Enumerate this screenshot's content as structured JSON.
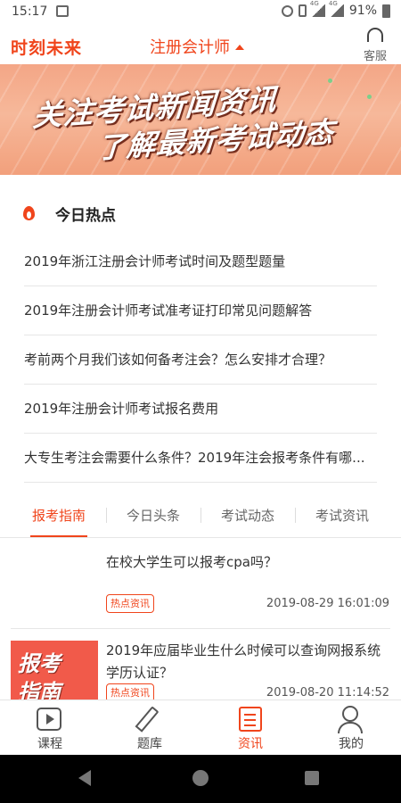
{
  "status_bar": {
    "time": "15:17",
    "signal_label_1": "4G",
    "signal_label_2": "4G",
    "battery": "91%"
  },
  "header": {
    "logo": "时刻未来",
    "title": "注册会计师",
    "service_label": "客服"
  },
  "banner": {
    "line1": "关注考试新闻资讯",
    "line2": "了解最新考试动态"
  },
  "hot": {
    "heading": "今日热点",
    "items": [
      {
        "label": "2019年浙江注册会计师考试时间及题型题量"
      },
      {
        "label": "2019年注册会计师考试准考证打印常见问题解答"
      },
      {
        "label": "考前两个月我们该如何备考注会？怎么安排才合理？"
      },
      {
        "label": "2019年注册会计师考试报名费用"
      },
      {
        "label": "大专生考注会需要什么条件？2019年注会报考条件有哪..."
      }
    ]
  },
  "tabs": [
    {
      "label": "报考指南",
      "active": true
    },
    {
      "label": "今日头条",
      "active": false
    },
    {
      "label": "考试动态",
      "active": false
    },
    {
      "label": "考试资讯",
      "active": false
    }
  ],
  "articles": [
    {
      "title": "在校大学生可以报考cpa吗？",
      "tag": "热点资讯",
      "date": "2019-08-29 16:01:09"
    },
    {
      "title": "2019年应届毕业生什么时候可以查询网报系统学历认证？",
      "tag": "热点资讯",
      "date": "2019-08-20 11:14:52",
      "thumb_line1": "报考",
      "thumb_line2": "指南"
    }
  ],
  "bottom_nav": [
    {
      "label": "课程",
      "icon": "play-course-icon"
    },
    {
      "label": "题库",
      "icon": "pencil-icon"
    },
    {
      "label": "资讯",
      "icon": "news-icon",
      "active": true
    },
    {
      "label": "我的",
      "icon": "person-icon"
    }
  ],
  "colors": {
    "accent": "#f0451c"
  }
}
